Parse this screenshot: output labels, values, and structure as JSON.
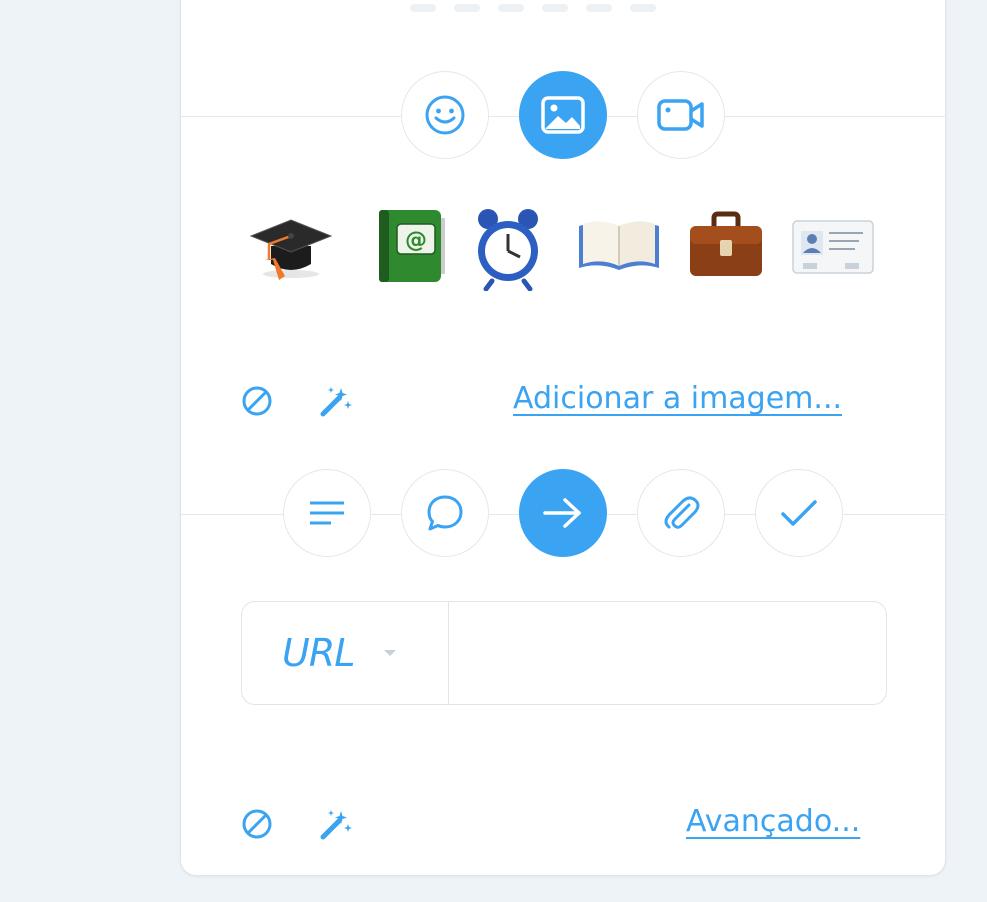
{
  "media_tabs": [
    {
      "name": "emoji",
      "icon": "smiley-icon",
      "active": false
    },
    {
      "name": "image",
      "icon": "image-icon",
      "active": true
    },
    {
      "name": "video",
      "icon": "video-camera-icon",
      "active": false
    }
  ],
  "image_gallery": [
    {
      "icon": "graduation-cap-icon"
    },
    {
      "icon": "address-book-icon"
    },
    {
      "icon": "alarm-clock-icon"
    },
    {
      "icon": "open-book-icon"
    },
    {
      "icon": "briefcase-icon"
    },
    {
      "icon": "id-card-icon"
    }
  ],
  "image_section": {
    "clear_icon": "clear-icon",
    "magic_icon": "magic-wand-icon",
    "add_link": "Adicionar a imagem..."
  },
  "action_tabs": [
    {
      "name": "text",
      "icon": "text-lines-icon",
      "active": false
    },
    {
      "name": "comment",
      "icon": "speech-bubble-icon",
      "active": false
    },
    {
      "name": "link",
      "icon": "arrow-right-icon",
      "active": true
    },
    {
      "name": "attachment",
      "icon": "paperclip-icon",
      "active": false
    },
    {
      "name": "check",
      "icon": "checkmark-icon",
      "active": false
    }
  ],
  "url_field": {
    "type_label": "URL",
    "value": "",
    "placeholder": ""
  },
  "advanced_section": {
    "clear_icon": "clear-icon",
    "magic_icon": "magic-wand-icon",
    "advanced_link": "Avançado..."
  },
  "colors": {
    "accent": "#3aa3f2",
    "border": "#dfe5ea",
    "background": "#eef3f7"
  }
}
